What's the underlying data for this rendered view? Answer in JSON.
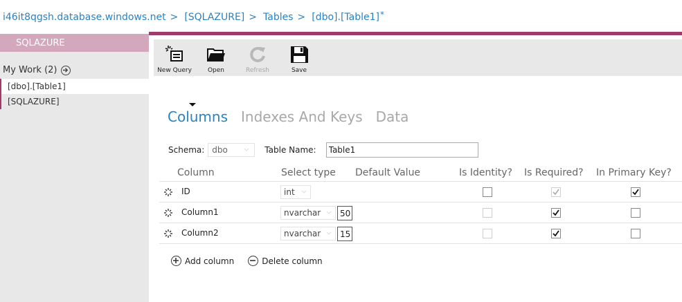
{
  "breadcrumb": {
    "items": [
      "i46it8qgsh.database.windows.net",
      "[SQLAZURE]",
      "Tables",
      "[dbo].[Table1]"
    ],
    "separator": ">",
    "dirty_marker": "*"
  },
  "sidebar": {
    "header": "SQLAZURE",
    "my_work_label": "My Work (2)",
    "items": [
      {
        "label": "[dbo].[Table1]"
      },
      {
        "label": "[SQLAZURE]"
      }
    ]
  },
  "toolbar": {
    "new_query": "New Query",
    "open": "Open",
    "refresh": "Refresh",
    "save": "Save"
  },
  "tabs": {
    "columns": "Columns",
    "indexes": "Indexes And Keys",
    "data": "Data"
  },
  "schema": {
    "label": "Schema:",
    "value": "dbo",
    "table_name_label": "Table Name:",
    "table_name_value": "Table1"
  },
  "grid": {
    "headers": {
      "column": "Column",
      "select_type": "Select type",
      "default_value": "Default Value",
      "is_identity": "Is Identity?",
      "is_required": "Is Required?",
      "in_primary_key": "In Primary Key?"
    },
    "rows": [
      {
        "name": "ID",
        "type": "int",
        "length": "",
        "is_identity": false,
        "is_required": true,
        "in_primary_key": true
      },
      {
        "name": "Column1",
        "type": "nvarchar",
        "length": "50",
        "is_identity": false,
        "is_required": true,
        "in_primary_key": false
      },
      {
        "name": "Column2",
        "type": "nvarchar",
        "length": "15",
        "is_identity": false,
        "is_required": true,
        "in_primary_key": false
      }
    ]
  },
  "actions": {
    "add_column": "Add column",
    "delete_column": "Delete column"
  },
  "colors": {
    "accent": "#a03a6a",
    "sidebar_header": "#d4a8bc",
    "link_blue": "#2a82c4"
  }
}
